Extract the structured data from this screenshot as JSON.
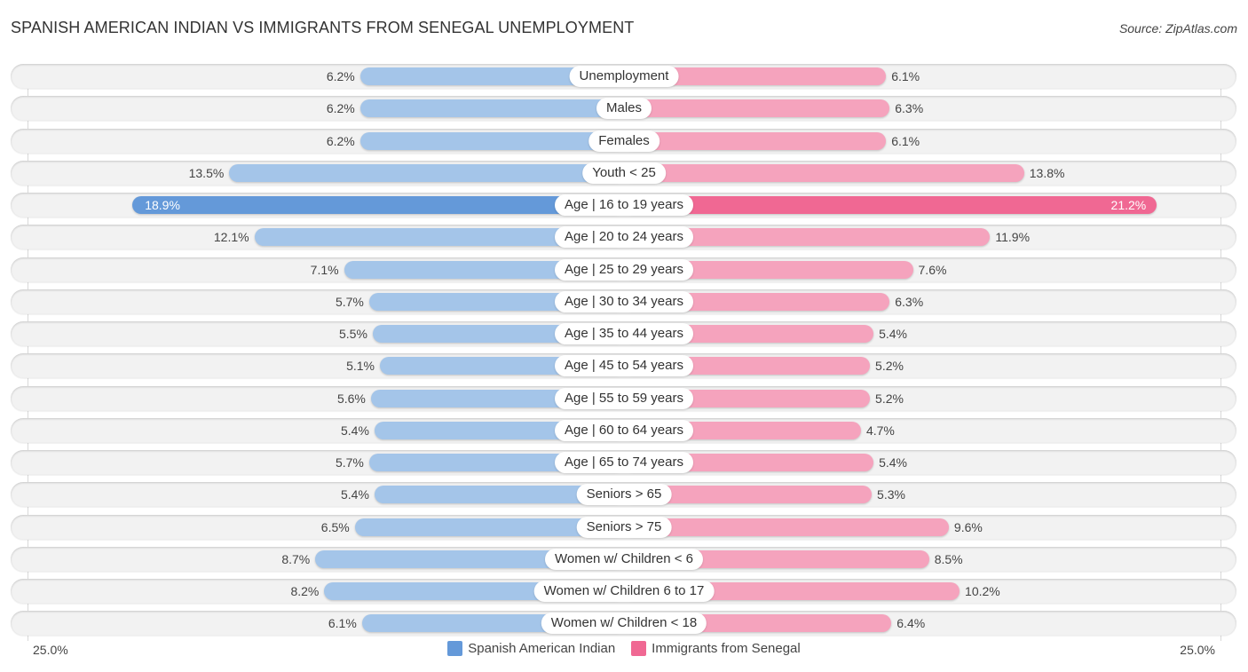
{
  "chart_data": {
    "type": "bar",
    "orientation": "horizontal-diverging",
    "title": "SPANISH AMERICAN INDIAN VS IMMIGRANTS FROM SENEGAL UNEMPLOYMENT",
    "source": "Source: ZipAtlas.com",
    "categories": [
      "Unemployment",
      "Males",
      "Females",
      "Youth < 25",
      "Age | 16 to 19 years",
      "Age | 20 to 24 years",
      "Age | 25 to 29 years",
      "Age | 30 to 34 years",
      "Age | 35 to 44 years",
      "Age | 45 to 54 years",
      "Age | 55 to 59 years",
      "Age | 60 to 64 years",
      "Age | 65 to 74 years",
      "Seniors > 65",
      "Seniors > 75",
      "Women w/ Children < 6",
      "Women w/ Children 6 to 17",
      "Women w/ Children < 18"
    ],
    "series": [
      {
        "name": "Spanish American Indian",
        "color": "#a4c5e9",
        "highlight_color": "#6499d9",
        "side": "left",
        "values": [
          6.2,
          6.2,
          6.2,
          13.5,
          18.9,
          12.1,
          7.1,
          5.7,
          5.5,
          5.1,
          5.6,
          5.4,
          5.7,
          5.4,
          6.5,
          8.7,
          8.2,
          6.1
        ],
        "labels": [
          "6.2%",
          "6.2%",
          "6.2%",
          "13.5%",
          "18.9%",
          "12.1%",
          "7.1%",
          "5.7%",
          "5.5%",
          "5.1%",
          "5.6%",
          "5.4%",
          "5.7%",
          "5.4%",
          "6.5%",
          "8.7%",
          "8.2%",
          "6.1%"
        ]
      },
      {
        "name": "Immigrants from Senegal",
        "color": "#f5a3bd",
        "highlight_color": "#f06893",
        "side": "right",
        "values": [
          6.1,
          6.3,
          6.1,
          13.8,
          21.2,
          11.9,
          7.6,
          6.3,
          5.4,
          5.2,
          5.2,
          4.7,
          5.4,
          5.3,
          9.6,
          8.5,
          10.2,
          6.4
        ],
        "labels": [
          "6.1%",
          "6.3%",
          "6.1%",
          "13.8%",
          "21.2%",
          "11.9%",
          "7.6%",
          "6.3%",
          "5.4%",
          "5.2%",
          "5.2%",
          "4.7%",
          "5.4%",
          "5.3%",
          "9.6%",
          "8.5%",
          "10.2%",
          "6.4%"
        ]
      }
    ],
    "highlight_index": 4,
    "xlim": [
      -25,
      25
    ],
    "axis_labels": {
      "left": "25.0%",
      "right": "25.0%"
    },
    "unit": "%",
    "legend_position": "bottom-center",
    "grid": false
  }
}
